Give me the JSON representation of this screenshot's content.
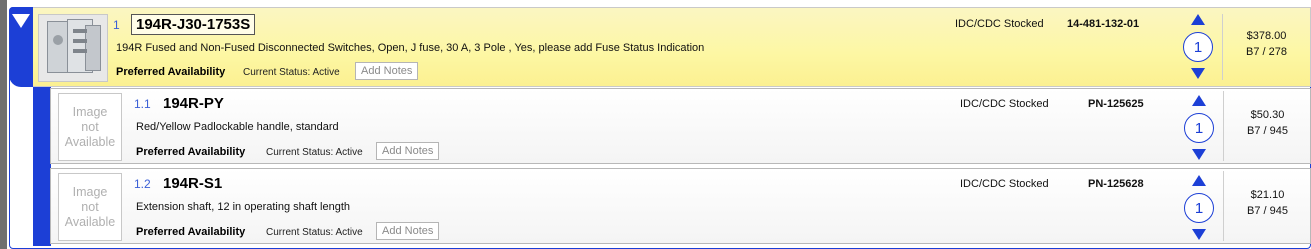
{
  "items": [
    {
      "index": "1",
      "part": "194R-J30-1753S",
      "description": "194R Fused and Non-Fused Disconnected Switches, Open, J fuse, 30 A, 3 Pole ,  Yes, please add Fuse Status Indication",
      "availability": "Preferred Availability",
      "status": "Current Status: Active",
      "notes_button": "Add Notes",
      "stock": "IDC/CDC Stocked",
      "pn": "14-481-132-01",
      "qty": "1",
      "price": "$378.00",
      "stock_count": "B7 / 278",
      "image": "product-photo"
    },
    {
      "index": "1.1",
      "part": "194R-PY",
      "description": "Red/Yellow Padlockable handle, standard",
      "availability": "Preferred Availability",
      "status": "Current Status: Active",
      "notes_button": "Add Notes",
      "stock": "IDC/CDC Stocked",
      "pn": "PN-125625",
      "qty": "1",
      "price": "$50.30",
      "stock_count": "B7 / 945",
      "image_placeholder": [
        "Image",
        "not",
        "Available"
      ]
    },
    {
      "index": "1.2",
      "part": "194R-S1",
      "description": "Extension shaft, 12 in operating shaft length",
      "availability": "Preferred Availability",
      "status": "Current Status: Active",
      "notes_button": "Add Notes",
      "stock": "IDC/CDC Stocked",
      "pn": "PN-125628",
      "qty": "1",
      "price": "$21.10",
      "stock_count": "B7 / 945",
      "image_placeholder": [
        "Image",
        "not",
        "Available"
      ]
    }
  ],
  "icons": {
    "collapse": "collapse-triangle-icon",
    "qty_up": "triangle-up-icon",
    "qty_down": "triangle-down-icon"
  },
  "colors": {
    "accent_blue": "#1c3fd6",
    "main_row_bg": "#fdf7a3",
    "sub_row_bg": "#f4f4f4",
    "index_blue": "#3a5fd6",
    "placeholder_gray": "#b0b0b0"
  }
}
